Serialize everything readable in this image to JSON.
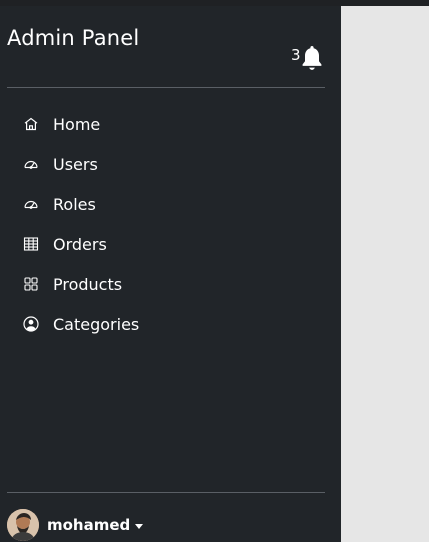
{
  "app": {
    "title": "Admin Panel"
  },
  "notifications": {
    "count": "3",
    "icon": "bell-icon"
  },
  "nav": {
    "items": [
      {
        "label": "Home",
        "icon": "home-icon"
      },
      {
        "label": "Users",
        "icon": "speedometer-icon"
      },
      {
        "label": "Roles",
        "icon": "speedometer-icon"
      },
      {
        "label": "Orders",
        "icon": "table-icon"
      },
      {
        "label": "Products",
        "icon": "grid-icon"
      },
      {
        "label": "Categories",
        "icon": "person-circle-icon"
      }
    ]
  },
  "user": {
    "name": "mohamed"
  },
  "colors": {
    "sidebar_bg": "#212529",
    "main_bg": "#e6e6e6",
    "divider": "#5a5f65",
    "text": "#ffffff"
  }
}
